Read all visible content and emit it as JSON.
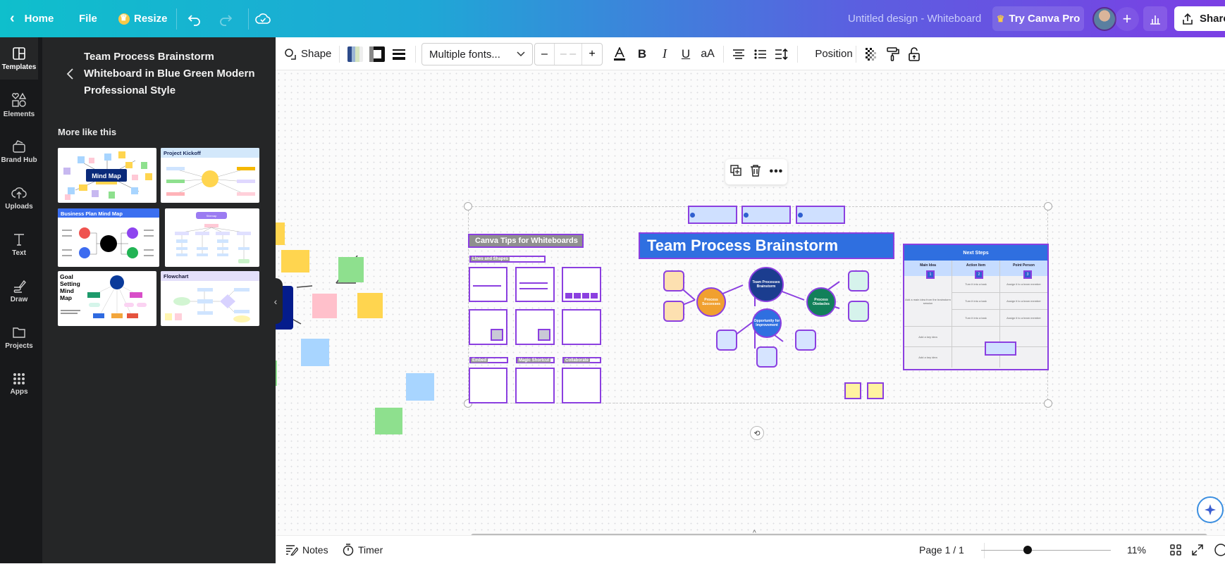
{
  "topbar": {
    "home_label": "Home",
    "file_label": "File",
    "resize_label": "Resize",
    "design_title": "Untitled design - Whiteboard",
    "try_pro_label": "Try Canva Pro",
    "share_label": "Share"
  },
  "rail": {
    "items": [
      {
        "label": "Templates",
        "icon": "templates-icon"
      },
      {
        "label": "Elements",
        "icon": "elements-icon"
      },
      {
        "label": "Brand Hub",
        "icon": "brand-hub-icon"
      },
      {
        "label": "Uploads",
        "icon": "uploads-icon"
      },
      {
        "label": "Text",
        "icon": "text-icon"
      },
      {
        "label": "Draw",
        "icon": "draw-icon"
      },
      {
        "label": "Projects",
        "icon": "projects-icon"
      },
      {
        "label": "Apps",
        "icon": "apps-icon"
      }
    ]
  },
  "panel": {
    "title": "Team Process Brainstorm Whiteboard in Blue Green Modern Professional Style",
    "section_label": "More like this",
    "templates": [
      {
        "title": "Mind Map"
      },
      {
        "title": "Project Kickoff"
      },
      {
        "title": "Business Plan Mind Map"
      },
      {
        "title": "Sitemap"
      },
      {
        "title": "Goal Setting Mind Map"
      },
      {
        "title": "Flowchart"
      }
    ]
  },
  "toolbar": {
    "shape_label": "Shape",
    "font_value": "Multiple fonts...",
    "font_size_value": "– –",
    "minus_label": "–",
    "plus_label": "+",
    "case_label": "aA",
    "position_label": "Position"
  },
  "canvas": {
    "tips_title": "Canva Tips for Whiteboards",
    "lines_shapes_label": "Lines and Shapes",
    "embed_label": "Embed",
    "magic_shortcut_label": "Magic Shortcut",
    "collaborate_label": "Collaborate",
    "main_title": "Team Process Brainstorm",
    "center_node": "Team Processes Brainstorm",
    "node_successes": "Process Successes",
    "node_obstacles": "Process Obstacles",
    "node_opportunity": "Opportunity for Improvement",
    "table": {
      "title": "Next Steps",
      "headers": [
        "Main Idea",
        "Action Item",
        "Point Person"
      ],
      "badges": [
        "1",
        "2",
        "3"
      ],
      "main_idea_note": "Add a main idea from the brainstorm session",
      "action_cells": [
        "Turn it into a task",
        "Turn it into a task",
        "Turn it into a task"
      ],
      "person_cells": [
        "Assign it to a team member",
        "Assign it to a team member",
        "Assign it to a team member"
      ],
      "key_ideas": [
        "Add a key idea",
        "Add a key idea"
      ]
    },
    "brand_color": "#8b3fe0"
  },
  "bottombar": {
    "notes_label": "Notes",
    "timer_label": "Timer",
    "page_label": "Page 1 / 1",
    "zoom_percent": "11%",
    "zoom_fraction": 0.11
  }
}
